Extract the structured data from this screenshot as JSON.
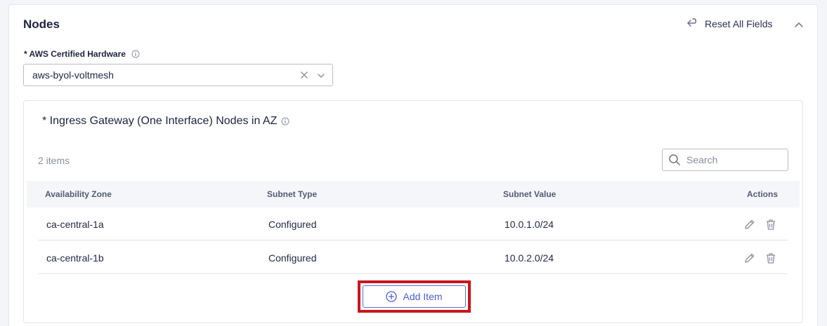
{
  "section": {
    "title": "Nodes",
    "reset_label": "Reset All Fields"
  },
  "hardware": {
    "label": "* AWS Certified Hardware",
    "value": "aws-byol-voltmesh"
  },
  "ingress": {
    "title": "* Ingress Gateway (One Interface) Nodes in AZ",
    "item_count": "2 items",
    "search_placeholder": "Search",
    "columns": [
      "Availability Zone",
      "Subnet Type",
      "Subnet Value",
      "Actions"
    ],
    "rows": [
      {
        "zone": "ca-central-1a",
        "subnet_type": "Configured",
        "subnet_value": "10.0.1.0/24"
      },
      {
        "zone": "ca-central-1b",
        "subnet_type": "Configured",
        "subnet_value": "10.0.2.0/24"
      }
    ],
    "add_label": "Add Item"
  },
  "colors": {
    "accent": "#4a5fd0",
    "highlight": "#c8161d",
    "text": "#222a45",
    "muted": "#8a8fa0"
  },
  "icons": [
    "undo-arrow-icon",
    "chevron-up-icon",
    "info-icon",
    "clear-icon",
    "chevron-down-icon",
    "search-icon",
    "edit-pencil-icon",
    "trash-icon",
    "plus-circle-icon"
  ]
}
